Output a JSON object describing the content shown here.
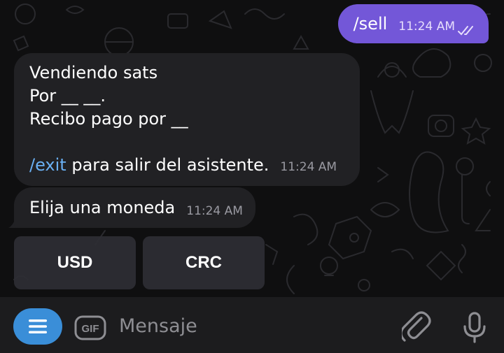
{
  "messages": {
    "outgoing": {
      "text": "/sell",
      "time": "11:24 AM",
      "status_icon": "double-check-icon"
    },
    "incoming_1": {
      "lines": [
        "Vendiendo sats",
        "Por __ __.",
        "Recibo pago por __"
      ],
      "command": "/exit",
      "command_suffix": " para salir del asistente.",
      "time": "11:24 AM"
    },
    "incoming_2": {
      "text": "Elija una moneda",
      "time": "11:24 AM"
    }
  },
  "keyboard": {
    "buttons": [
      "USD",
      "CRC"
    ]
  },
  "input_bar": {
    "menu_icon": "menu-icon",
    "gif_label": "GIF",
    "placeholder": "Mensaje",
    "value": "",
    "attach_icon": "paperclip-icon",
    "mic_icon": "microphone-icon"
  },
  "colors": {
    "outgoing_bubble": "#7357d8",
    "incoming_bubble": "#212124",
    "command_link": "#6ab0f3",
    "menu_button": "#3a8ed8",
    "background": "#0f0f10"
  }
}
